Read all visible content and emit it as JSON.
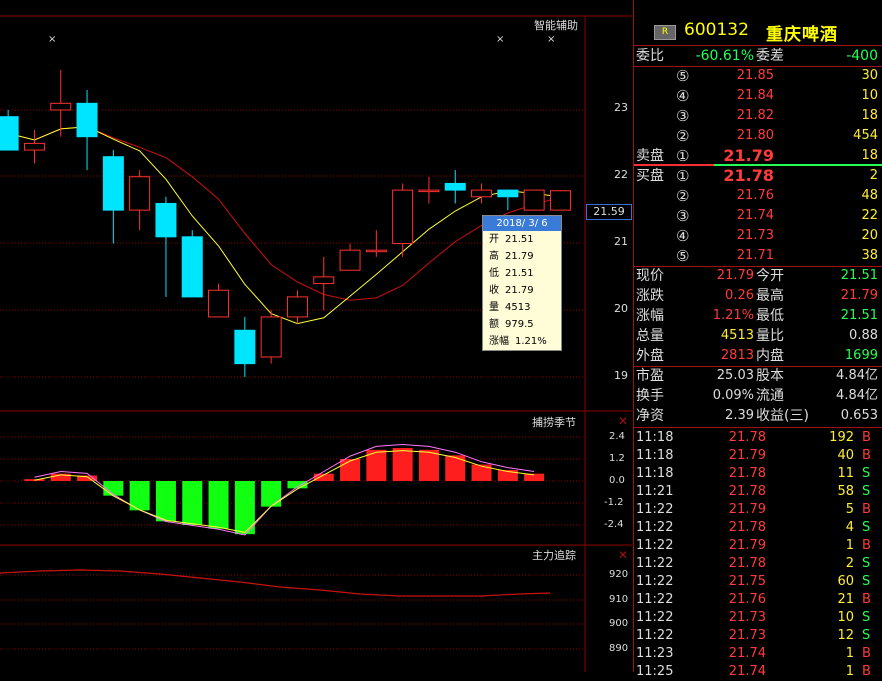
{
  "main_chart": {
    "title": "智能辅助",
    "price_ticks": [
      "23",
      "22",
      "21",
      "20",
      "19"
    ],
    "current_price_box": "21.59",
    "markers": [
      "×",
      "×",
      "×"
    ]
  },
  "tooltip": {
    "date": "2018/ 3/ 6",
    "rows": [
      {
        "k": "开",
        "v": "21.51"
      },
      {
        "k": "高",
        "v": "21.79"
      },
      {
        "k": "低",
        "v": "21.51"
      },
      {
        "k": "收",
        "v": "21.79"
      },
      {
        "k": "量",
        "v": "4513"
      },
      {
        "k": "额",
        "v": "979.5"
      },
      {
        "k": "涨幅",
        "v": "1.21%"
      }
    ]
  },
  "indicator1": {
    "title": "捕捞季节",
    "ticks": [
      "2.4",
      "1.2",
      "0.0",
      "-1.2",
      "-2.4"
    ],
    "bar_values": [
      0.1,
      0.4,
      0.3,
      -0.8,
      -1.6,
      -2.2,
      -2.4,
      -2.6,
      -2.9,
      -1.4,
      -0.4,
      0.4,
      1.2,
      1.7,
      1.8,
      1.7,
      1.4,
      0.9,
      0.6,
      0.4
    ]
  },
  "indicator2": {
    "title": "主力追踪",
    "ticks": [
      "920",
      "910",
      "900",
      "890"
    ]
  },
  "chart_data": {
    "type": "candlestick",
    "ylabel": "",
    "ylim": [
      18.5,
      23.5
    ],
    "candles": [
      {
        "o": 22.9,
        "h": 23.0,
        "l": 22.4,
        "c": 22.4
      },
      {
        "o": 22.4,
        "h": 22.7,
        "l": 22.2,
        "c": 22.5
      },
      {
        "o": 23.0,
        "h": 23.6,
        "l": 22.6,
        "c": 23.1
      },
      {
        "o": 23.1,
        "h": 23.3,
        "l": 22.1,
        "c": 22.6
      },
      {
        "o": 22.3,
        "h": 22.4,
        "l": 21.0,
        "c": 21.5
      },
      {
        "o": 21.5,
        "h": 22.1,
        "l": 21.2,
        "c": 22.0
      },
      {
        "o": 21.6,
        "h": 21.7,
        "l": 20.2,
        "c": 21.1
      },
      {
        "o": 21.1,
        "h": 21.2,
        "l": 20.2,
        "c": 20.2
      },
      {
        "o": 19.9,
        "h": 20.4,
        "l": 19.9,
        "c": 20.3
      },
      {
        "o": 19.7,
        "h": 19.9,
        "l": 19.0,
        "c": 19.2
      },
      {
        "o": 19.3,
        "h": 20.0,
        "l": 19.2,
        "c": 19.9
      },
      {
        "o": 19.9,
        "h": 20.3,
        "l": 19.8,
        "c": 20.2
      },
      {
        "o": 20.4,
        "h": 20.8,
        "l": 20.0,
        "c": 20.5
      },
      {
        "o": 20.6,
        "h": 21.0,
        "l": 20.6,
        "c": 20.9
      },
      {
        "o": 20.9,
        "h": 21.2,
        "l": 20.8,
        "c": 20.9
      },
      {
        "o": 21.0,
        "h": 21.9,
        "l": 20.8,
        "c": 21.8
      },
      {
        "o": 21.8,
        "h": 22.0,
        "l": 21.6,
        "c": 21.8
      },
      {
        "o": 21.9,
        "h": 22.1,
        "l": 21.6,
        "c": 21.8
      },
      {
        "o": 21.7,
        "h": 21.9,
        "l": 21.6,
        "c": 21.8
      },
      {
        "o": 21.8,
        "h": 21.8,
        "l": 21.5,
        "c": 21.7
      },
      {
        "o": 21.5,
        "h": 21.8,
        "l": 21.5,
        "c": 21.8
      },
      {
        "o": 21.5,
        "h": 21.8,
        "l": 21.5,
        "c": 21.79
      }
    ]
  },
  "stock": {
    "badge": "R",
    "code": "600132",
    "name": "重庆啤酒"
  },
  "weibi": {
    "label1": "委比",
    "v1": "-60.61%",
    "label2": "委差",
    "v2": "-400"
  },
  "asks": [
    {
      "n": "⑤",
      "price": "21.85",
      "vol": "30"
    },
    {
      "n": "④",
      "price": "21.84",
      "vol": "10"
    },
    {
      "n": "③",
      "price": "21.82",
      "vol": "18"
    },
    {
      "n": "②",
      "price": "21.80",
      "vol": "454"
    },
    {
      "n": "①",
      "price": "21.79",
      "vol": "18",
      "label": "卖盘"
    }
  ],
  "bids": [
    {
      "n": "①",
      "price": "21.78",
      "vol": "2",
      "label": "买盘"
    },
    {
      "n": "②",
      "price": "21.76",
      "vol": "48"
    },
    {
      "n": "③",
      "price": "21.74",
      "vol": "22"
    },
    {
      "n": "④",
      "price": "21.73",
      "vol": "20"
    },
    {
      "n": "⑤",
      "price": "21.71",
      "vol": "38"
    }
  ],
  "stats": [
    {
      "l1": "现价",
      "v1": "21.79",
      "c1": "red",
      "l2": "今开",
      "v2": "21.51",
      "c2": "grn"
    },
    {
      "l1": "涨跌",
      "v1": "0.26",
      "c1": "red",
      "l2": "最高",
      "v2": "21.79",
      "c2": "red"
    },
    {
      "l1": "涨幅",
      "v1": "1.21%",
      "c1": "red",
      "l2": "最低",
      "v2": "21.51",
      "c2": "grn"
    },
    {
      "l1": "总量",
      "v1": "4513",
      "c1": "yel",
      "l2": "量比",
      "v2": "0.88",
      "c2": "wht"
    },
    {
      "l1": "外盘",
      "v1": "2813",
      "c1": "red",
      "l2": "内盘",
      "v2": "1699",
      "c2": "grn"
    }
  ],
  "fundamentals": [
    {
      "l1": "市盈",
      "v1": "25.03",
      "l2": "股本",
      "v2": "4.84亿"
    },
    {
      "l1": "换手",
      "v1": "0.09%",
      "l2": "流通",
      "v2": "4.84亿"
    },
    {
      "l1": "净资",
      "v1": "2.39",
      "l2": "收益(三)",
      "v2": "0.653"
    }
  ],
  "ticks": [
    {
      "t": "11:18",
      "p": "21.78",
      "v": "192",
      "d": "B"
    },
    {
      "t": "11:18",
      "p": "21.79",
      "v": "40",
      "d": "B"
    },
    {
      "t": "11:18",
      "p": "21.78",
      "v": "11",
      "d": "S"
    },
    {
      "t": "11:21",
      "p": "21.78",
      "v": "58",
      "d": "S"
    },
    {
      "t": "11:22",
      "p": "21.79",
      "v": "5",
      "d": "B"
    },
    {
      "t": "11:22",
      "p": "21.78",
      "v": "4",
      "d": "S"
    },
    {
      "t": "11:22",
      "p": "21.79",
      "v": "1",
      "d": "B"
    },
    {
      "t": "11:22",
      "p": "21.78",
      "v": "2",
      "d": "S"
    },
    {
      "t": "11:22",
      "p": "21.75",
      "v": "60",
      "d": "S"
    },
    {
      "t": "11:22",
      "p": "21.76",
      "v": "21",
      "d": "B"
    },
    {
      "t": "11:22",
      "p": "21.73",
      "v": "10",
      "d": "S"
    },
    {
      "t": "11:22",
      "p": "21.73",
      "v": "12",
      "d": "S"
    },
    {
      "t": "11:23",
      "p": "21.74",
      "v": "1",
      "d": "B"
    },
    {
      "t": "11:25",
      "p": "21.74",
      "v": "1",
      "d": "B"
    }
  ],
  "colors": {
    "up": "#ff3030",
    "down": "#00e5ff",
    "grid": "#8b0000",
    "ma1": "#ffff33",
    "ma2": "#d01010"
  }
}
